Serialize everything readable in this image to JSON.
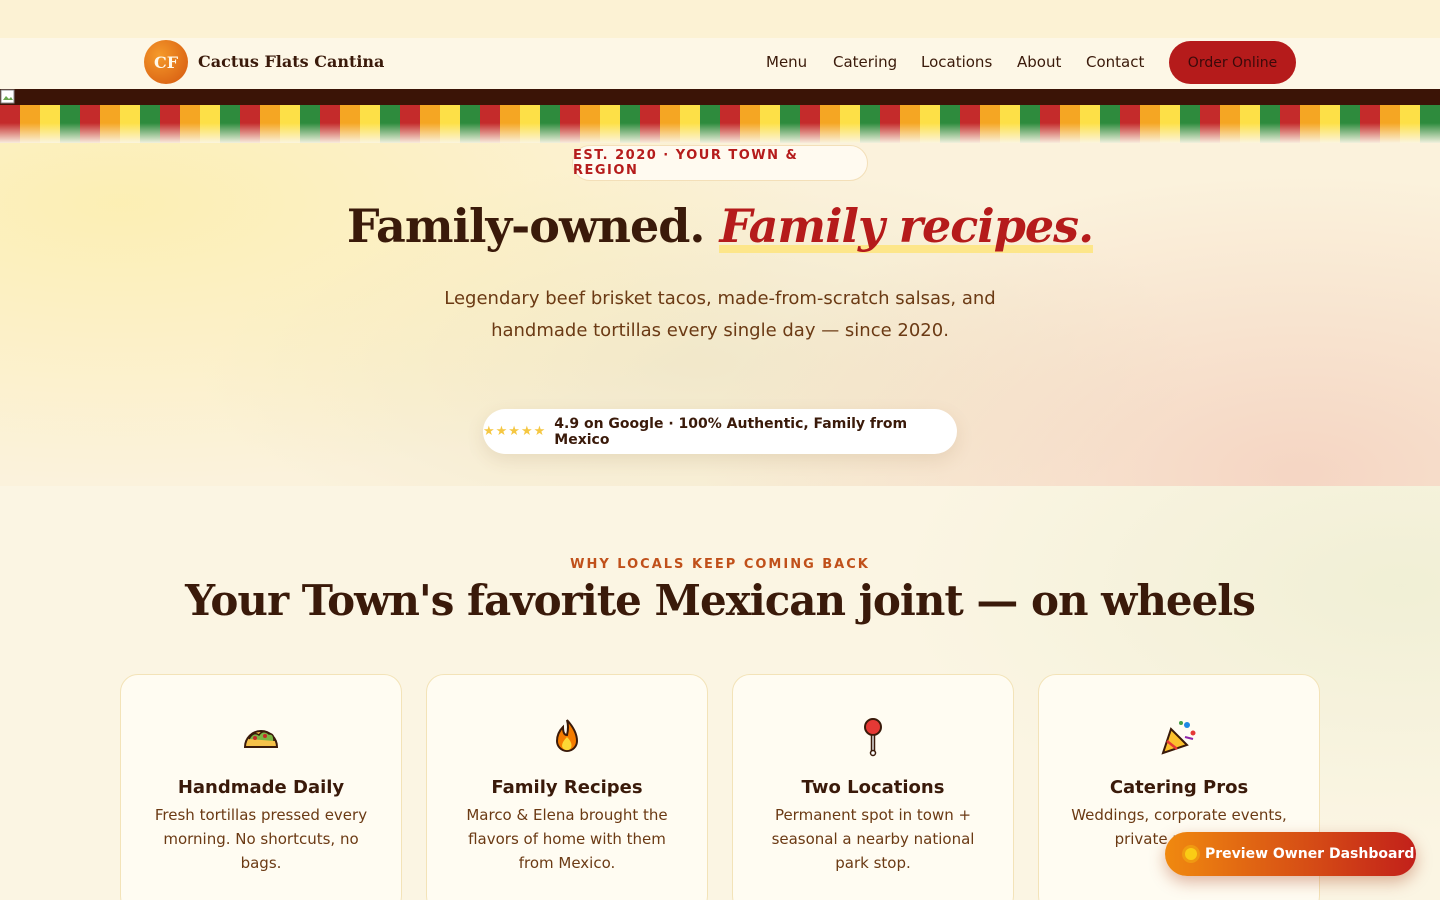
{
  "nav": {
    "logo_initials": "CF",
    "brand": "Cactus Flats Cantina",
    "links": [
      "Menu",
      "Catering",
      "Locations",
      "About",
      "Contact"
    ],
    "order_button": "Order Online"
  },
  "banner": {
    "stripe_colors": [
      "#c42b2b",
      "#f5a623",
      "#fde047",
      "#2e8b3d"
    ]
  },
  "hero": {
    "est_badge": "EST. 2020 · YOUR TOWN & REGION",
    "headline_plain": "Family-owned.",
    "headline_accent": "Family recipes.",
    "subtext": "Legendary beef brisket tacos, made-from-scratch salsas, and handmade tortillas every single day — since 2020.",
    "stars": "★★★★★",
    "rating_text": "4.9 on Google · 100% Authentic, Family from Mexico"
  },
  "features": {
    "eyebrow": "WHY LOCALS KEEP COMING BACK",
    "title": "Your Town's favorite Mexican joint — on wheels",
    "cards": [
      {
        "icon": "taco-icon",
        "title": "Handmade Daily",
        "text": "Fresh tortillas pressed every morning. No shortcuts, no bags."
      },
      {
        "icon": "fire-icon",
        "title": "Family Recipes",
        "text": "Marco & Elena brought the flavors of home with them from Mexico."
      },
      {
        "icon": "pin-icon",
        "title": "Two Locations",
        "text": "Permanent spot in town + seasonal a nearby national park stop."
      },
      {
        "icon": "party-popper-icon",
        "title": "Catering Pros",
        "text": "Weddings, corporate events, private parties, p"
      }
    ]
  },
  "floating": {
    "preview_button": "Preview Owner Dashboard"
  },
  "colors": {
    "accent_red": "#b51b1b",
    "dark_brown": "#3a1a0a",
    "orange": "#c0501a"
  }
}
